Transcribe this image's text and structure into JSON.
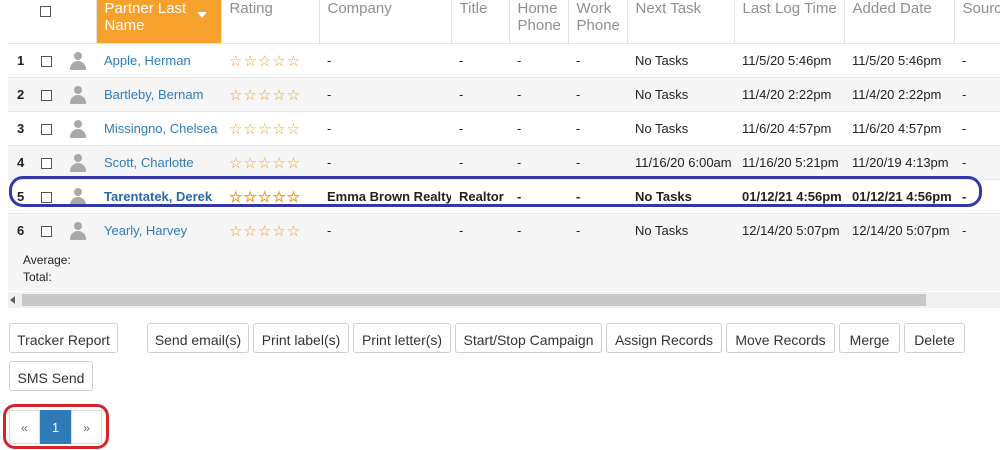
{
  "columns": {
    "partner_last_name": "Partner Last Name",
    "rating": "Rating",
    "company": "Company",
    "title": "Title",
    "home_phone": "Home Phone",
    "work_phone": "Work Phone",
    "next_task": "Next Task",
    "last_log_time": "Last Log Time",
    "added_date": "Added Date",
    "source": "Source"
  },
  "rows": [
    {
      "num": "1",
      "name": "Apple, Herman",
      "rating": 0,
      "company": "-",
      "title": "-",
      "home_phone": "-",
      "work_phone": "-",
      "next_task": "No Tasks",
      "last_log": "11/5/20 5:46pm",
      "added": "11/5/20 5:46pm",
      "source": "-"
    },
    {
      "num": "2",
      "name": "Bartleby, Bernam",
      "rating": 0,
      "company": "-",
      "title": "-",
      "home_phone": "-",
      "work_phone": "-",
      "next_task": "No Tasks",
      "last_log": "11/4/20 2:22pm",
      "added": "11/4/20 2:22pm",
      "source": "-"
    },
    {
      "num": "3",
      "name": "Missingno, Chelsea",
      "rating": 0,
      "company": "-",
      "title": "-",
      "home_phone": "-",
      "work_phone": "-",
      "next_task": "No Tasks",
      "last_log": "11/6/20 4:57pm",
      "added": "11/6/20 4:57pm",
      "source": "-"
    },
    {
      "num": "4",
      "name": "Scott, Charlotte",
      "rating": 0,
      "company": "-",
      "title": "-",
      "home_phone": "-",
      "work_phone": "-",
      "next_task": "11/16/20 6:00am",
      "last_log": "11/16/20 5:21pm",
      "added": "11/20/19 4:13pm",
      "source": "-"
    },
    {
      "num": "5",
      "name": "Tarentatek, Derek",
      "rating": 0,
      "company": "Emma Brown Realty",
      "title": "Realtor",
      "home_phone": "-",
      "work_phone": "-",
      "next_task": "No Tasks",
      "last_log": "01/12/21 4:56pm",
      "added": "01/12/21 4:56pm",
      "source": "-"
    },
    {
      "num": "6",
      "name": "Yearly, Harvey",
      "rating": 0,
      "company": "-",
      "title": "-",
      "home_phone": "-",
      "work_phone": "-",
      "next_task": "No Tasks",
      "last_log": "12/14/20 5:07pm",
      "added": "12/14/20 5:07pm",
      "source": "-"
    }
  ],
  "stars": "☆☆☆☆☆",
  "summary": {
    "average_label": "Average:",
    "total_label": "Total:"
  },
  "buttons": {
    "tracker_report": "Tracker Report",
    "send_email": "Send email(s)",
    "print_labels": "Print label(s)",
    "print_letters": "Print letter(s)",
    "start_stop_campaign": "Start/Stop Campaign",
    "assign_records": "Assign Records",
    "move_records": "Move Records",
    "merge": "Merge",
    "delete": "Delete",
    "sms_send": "SMS Send"
  },
  "pager": {
    "prev": "«",
    "current": "1",
    "next": "»"
  },
  "colors": {
    "accent_sort": "#f6a12b",
    "link": "#2e7bb8",
    "star": "#f3a01a",
    "row_highlight": "#3438a6",
    "pager_highlight": "#d5242a"
  }
}
